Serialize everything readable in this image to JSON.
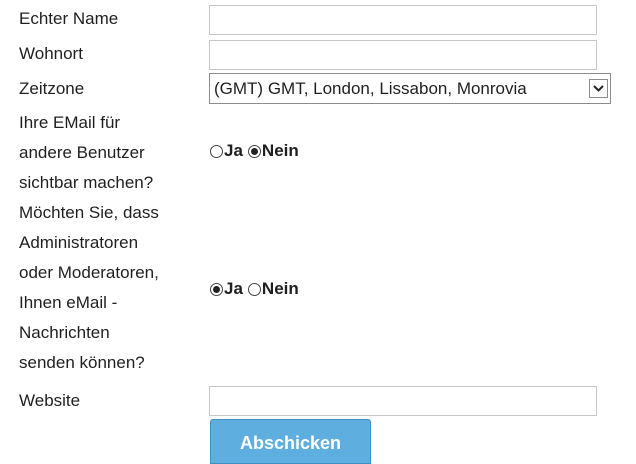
{
  "form": {
    "real_name": {
      "label": "Echter Name",
      "value": ""
    },
    "location": {
      "label": "Wohnort",
      "value": ""
    },
    "timezone": {
      "label": "Zeitzone",
      "selected": "(GMT) GMT, London, Lissabon, Monrovia"
    },
    "email_visible": {
      "label_lines": [
        "Ihre EMail für",
        "andere Benutzer",
        "sichtbar machen?"
      ],
      "options": [
        "Ja",
        "Nein"
      ],
      "selected": "Nein"
    },
    "admin_email": {
      "label_lines": [
        "Möchten Sie, dass",
        "Administratoren",
        "oder Moderatoren,",
        "Ihnen eMail -",
        "Nachrichten",
        "senden können?"
      ],
      "options": [
        "Ja",
        "Nein"
      ],
      "selected": "Ja"
    },
    "website": {
      "label": "Website",
      "value": ""
    },
    "submit_label": "Abschicken"
  },
  "colors": {
    "button_bg": "#5faee0",
    "button_border": "#3f8fc4",
    "button_text": "#ffffff"
  }
}
